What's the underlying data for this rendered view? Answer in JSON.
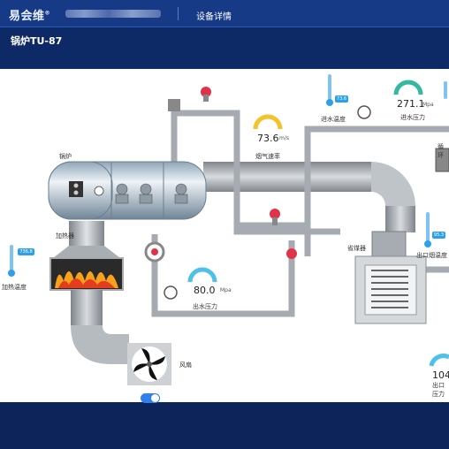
{
  "app": {
    "logo": "易会维",
    "logo_mark": "®"
  },
  "nav": {
    "tab": "设备详情"
  },
  "page": {
    "title": "锅炉TU-87"
  },
  "labels": {
    "boiler": "锅炉",
    "heater": "加热器",
    "heat_temp": "加热温度",
    "flue_speed": "烟气速率",
    "inlet_temp": "进水温度",
    "inlet_pressure": "进水压力",
    "economizer": "省煤器",
    "outlet_pressure": "出水压力",
    "outlet_flue_temp": "出口烟温度",
    "outlet_pressure_right": "出口压力",
    "fan": "风扇",
    "pump": "循环"
  },
  "gauges": {
    "flue_speed": {
      "value": "73.6",
      "unit": "m/s"
    },
    "outlet_pressure": {
      "value": "80.0",
      "unit": "Mpa"
    },
    "inlet_pressure": {
      "value": "271.1",
      "unit": "Mpa"
    },
    "bottom_right": {
      "value": "104"
    }
  },
  "thermometers": {
    "heat_temp": "736.8",
    "inlet_temp": "73.6",
    "outlet_flue_temp": "95.3"
  },
  "colors": {
    "accent": "#2ea0ea",
    "header": "#163a86",
    "pipe": "#9ca2a8"
  },
  "icons": {
    "fan": "fan-icon",
    "valve": "valve-icon",
    "pressure": "pressure-gauge-icon",
    "thermo": "thermometer-icon"
  },
  "controls": {
    "fan_toggle_on": true
  }
}
